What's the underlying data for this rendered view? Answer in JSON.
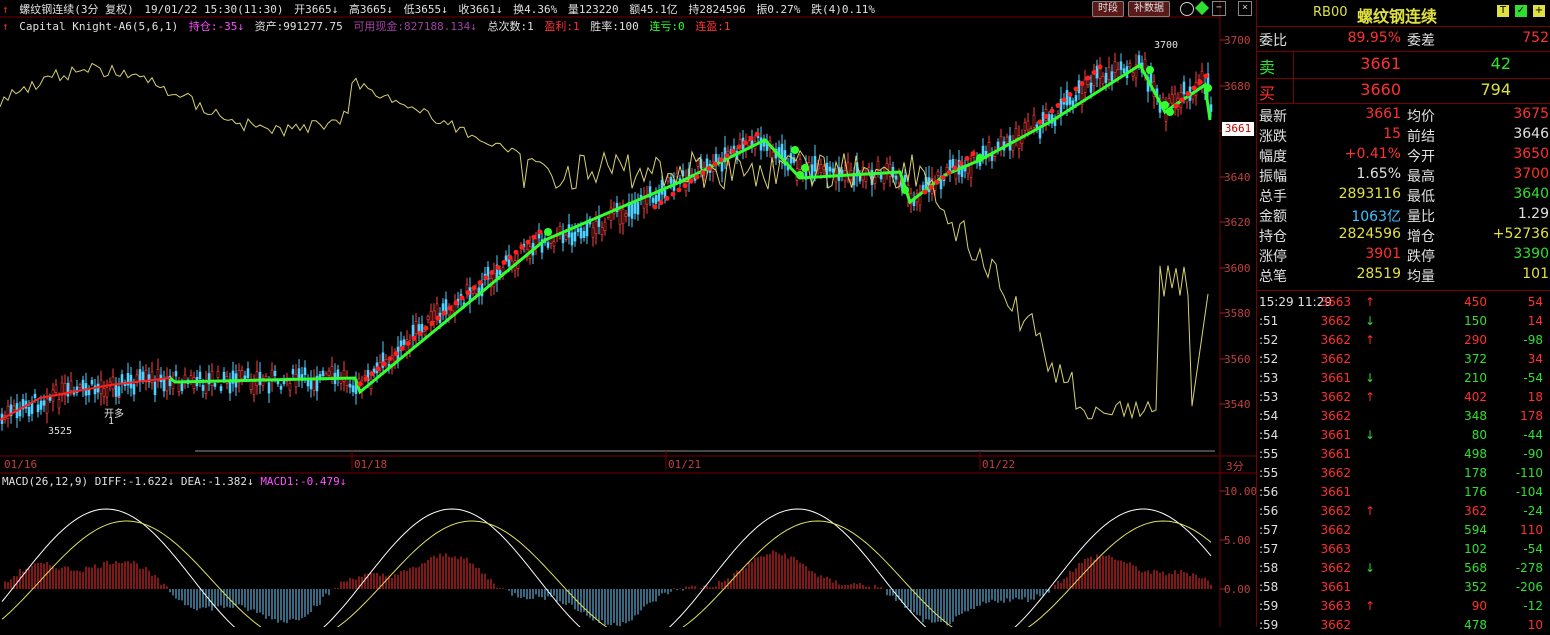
{
  "header": {
    "symbol": "螺纹钢连续(3分 复权)",
    "datetime": "19/01/22 15:30(11:30)",
    "open": "开3665↓",
    "high": "高3665↓",
    "low": "低3655↓",
    "close": "收3661↓",
    "turnover": "换4.36%",
    "volume": "量123220",
    "amount": "额45.1亿",
    "position": "持2824596",
    "amplitude": "振0.27%",
    "change": "跌(4)0.11%",
    "btn_time": "时段",
    "btn_fill": "补数据"
  },
  "strategy": {
    "name": "Capital Knight-A6(5,6,1)",
    "holding": "持仓:-35↓",
    "assets": "资产:991277.75",
    "cash": "可用现金:827188.134↓",
    "trades": "总次数:1",
    "profit": "盈利:1",
    "winrate": "胜率:100",
    "losses": "连亏:0",
    "wins": "连盈:1"
  },
  "price_axis": {
    "ticks": [
      "3700",
      "3680",
      "3660",
      "3640",
      "3620",
      "3600",
      "3580",
      "3560",
      "3540"
    ],
    "current": "3661",
    "period": "3分"
  },
  "date_axis": [
    "01/16",
    "01/18",
    "01/21",
    "01/22"
  ],
  "macd": {
    "label": "MACD(26,12,9)",
    "diff": "DIFF:-1.622↓",
    "dea": "DEA:-1.382↓",
    "macd": "MACD1:-0.479↓",
    "ticks": [
      "10.00",
      "5.00",
      "0.00"
    ]
  },
  "annotations": {
    "low_label": "3525",
    "high_label": "3700",
    "open_long": "开多",
    "qty1": "1"
  },
  "quote": {
    "code": "RB00",
    "name": "螺纹钢连续",
    "wb_label": "委比",
    "wb_value": "89.95%",
    "wc_label": "委差",
    "wc_value": "752",
    "sell_label": "卖",
    "sell_price": "3661",
    "sell_vol": "42",
    "buy_label": "买",
    "buy_price": "3660",
    "buy_vol": "794",
    "stats": [
      {
        "l1": "最新",
        "v1": "3661",
        "c1": "#ff3030",
        "l2": "均价",
        "v2": "3675",
        "c2": "#ff3030"
      },
      {
        "l1": "涨跌",
        "v1": "15",
        "c1": "#ff3030",
        "l2": "前结",
        "v2": "3646",
        "c2": "#e0e0e0"
      },
      {
        "l1": "幅度",
        "v1": "+0.41%",
        "c1": "#ff3030",
        "l2": "今开",
        "v2": "3650",
        "c2": "#ff3030"
      },
      {
        "l1": "振幅",
        "v1": "1.65%",
        "c1": "#e0e0e0",
        "l2": "最高",
        "v2": "3700",
        "c2": "#ff3030"
      },
      {
        "l1": "总手",
        "v1": "2893116",
        "c1": "#e0e040",
        "l2": "最低",
        "v2": "3640",
        "c2": "#30e030"
      },
      {
        "l1": "金额",
        "v1": "1063亿",
        "c1": "#40c0ff",
        "l2": "量比",
        "v2": "1.29",
        "c2": "#e0e0e0"
      },
      {
        "l1": "持仓",
        "v1": "2824596",
        "c1": "#e0e040",
        "l2": "增仓",
        "v2": "+52736",
        "c2": "#e0e040"
      },
      {
        "l1": "涨停",
        "v1": "3901",
        "c1": "#ff3030",
        "l2": "跌停",
        "v2": "3390",
        "c2": "#30e030"
      },
      {
        "l1": "总笔",
        "v1": "28519",
        "c1": "#e0e040",
        "l2": "均量",
        "v2": "101",
        "c2": "#e0e040"
      }
    ],
    "ticks": [
      {
        "t": "15:29 11:29",
        "p": "3663",
        "d": "↑",
        "v": "450",
        "c": "54"
      },
      {
        "t": ":51",
        "p": "3662",
        "d": "↓",
        "v": "150",
        "c": "14"
      },
      {
        "t": ":52",
        "p": "3662",
        "d": "↑",
        "v": "290",
        "c": "-98"
      },
      {
        "t": ":52",
        "p": "3662",
        "d": "",
        "v": "372",
        "c": "34"
      },
      {
        "t": ":53",
        "p": "3661",
        "d": "↓",
        "v": "210",
        "c": "-54"
      },
      {
        "t": ":53",
        "p": "3662",
        "d": "↑",
        "v": "402",
        "c": "18"
      },
      {
        "t": ":54",
        "p": "3662",
        "d": "",
        "v": "348",
        "c": "178"
      },
      {
        "t": ":54",
        "p": "3661",
        "d": "↓",
        "v": "80",
        "c": "-44"
      },
      {
        "t": ":55",
        "p": "3661",
        "d": "",
        "v": "498",
        "c": "-90"
      },
      {
        "t": ":55",
        "p": "3662",
        "d": "",
        "v": "178",
        "c": "-110"
      },
      {
        "t": ":56",
        "p": "3661",
        "d": "",
        "v": "176",
        "c": "-104"
      },
      {
        "t": ":56",
        "p": "3662",
        "d": "↑",
        "v": "362",
        "c": "-24"
      },
      {
        "t": ":57",
        "p": "3662",
        "d": "",
        "v": "594",
        "c": "110"
      },
      {
        "t": ":57",
        "p": "3663",
        "d": "",
        "v": "102",
        "c": "-54"
      },
      {
        "t": ":58",
        "p": "3662",
        "d": "↓",
        "v": "568",
        "c": "-278"
      },
      {
        "t": ":58",
        "p": "3661",
        "d": "",
        "v": "352",
        "c": "-206"
      },
      {
        "t": ":59",
        "p": "3663",
        "d": "↑",
        "v": "90",
        "c": "-12"
      },
      {
        "t": ":59",
        "p": "3662",
        "d": "",
        "v": "478",
        "c": "10"
      }
    ]
  }
}
